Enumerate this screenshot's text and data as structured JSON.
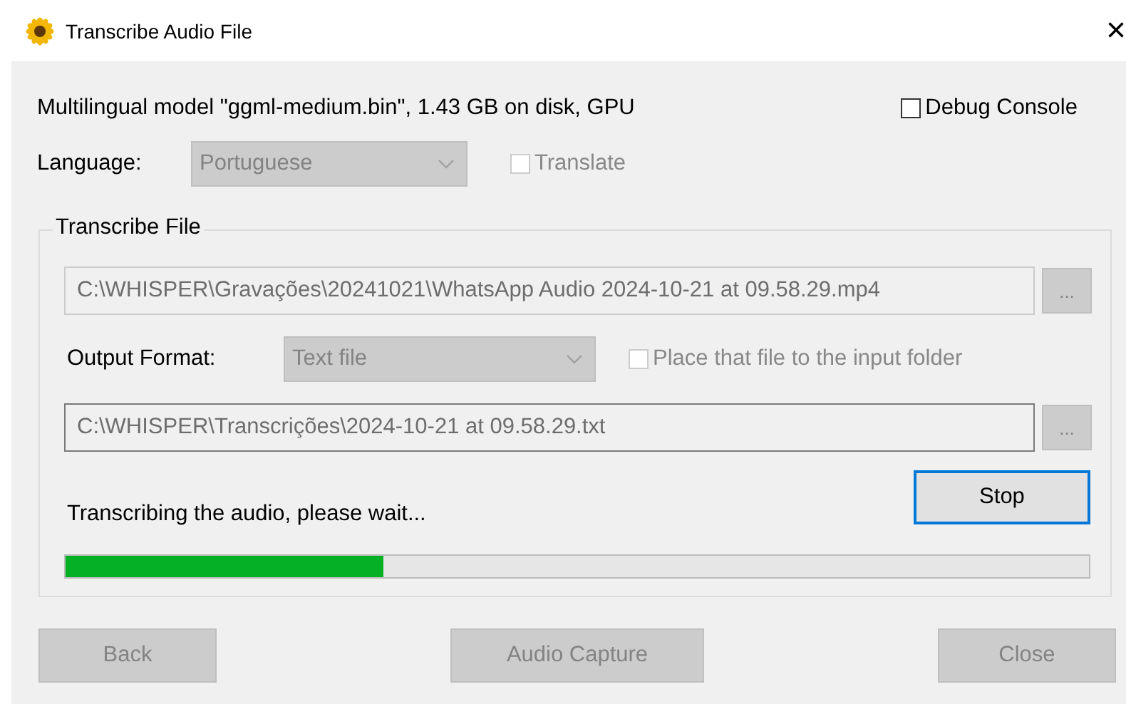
{
  "window": {
    "title": "Transcribe Audio File",
    "close": "×"
  },
  "model_info": "Multilingual model \"ggml-medium.bin\", 1.43 GB on disk, GPU",
  "debug_console": {
    "label": "Debug Console",
    "checked": false,
    "disabled": false
  },
  "language": {
    "label": "Language:",
    "value": "Portuguese",
    "disabled": true
  },
  "translate": {
    "label": "Translate",
    "checked": false,
    "disabled": true
  },
  "group": {
    "title": "Transcribe File",
    "input_path": {
      "value": "C:\\WHISPER\\Gravações\\20241021\\WhatsApp Audio 2024-10-21 at 09.58.29.mp4",
      "disabled": true,
      "browse": "...",
      "browse_disabled": true
    },
    "output_format": {
      "label": "Output Format:",
      "value": "Text file",
      "disabled": true
    },
    "place_in_input": {
      "label": "Place that file to the input folder",
      "checked": false,
      "disabled": true
    },
    "output_path": {
      "value": "C:\\WHISPER\\Transcrições\\2024-10-21 at 09.58.29.txt",
      "disabled": false,
      "browse": "...",
      "browse_disabled": true
    },
    "stop_button": {
      "label": "Stop",
      "disabled": false,
      "focused": true
    },
    "status": "Transcribing the audio, please wait...",
    "progress": {
      "level": 0.31
    }
  },
  "buttons": [
    {
      "label": "Back",
      "disabled": true
    },
    {
      "label": "Audio Capture",
      "disabled": true
    },
    {
      "label": "Close",
      "disabled": true
    }
  ]
}
